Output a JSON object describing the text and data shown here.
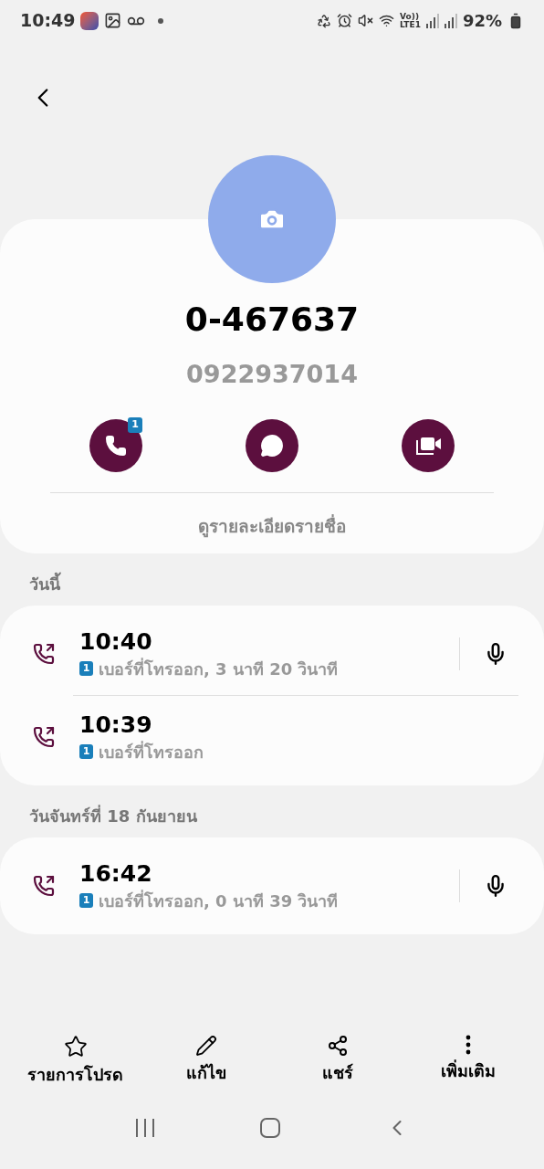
{
  "status_bar": {
    "time": "10:49",
    "volte": "Vo))",
    "network": "LTE1",
    "battery": "92%"
  },
  "contact": {
    "name": "0-467637",
    "number": "0922937014",
    "actions": [
      {
        "kind": "call",
        "badge": "1"
      },
      {
        "kind": "message"
      },
      {
        "kind": "video"
      }
    ],
    "details_link": "ดูรายละเอียดรายชื่อ"
  },
  "sections": [
    {
      "header": "วันนี้",
      "calls": [
        {
          "time": "10:40",
          "sim": "1",
          "detail": "เบอร์ที่โทรออก, 3 นาที 20 วินาที",
          "recording": true
        },
        {
          "time": "10:39",
          "sim": "1",
          "detail": "เบอร์ที่โทรออก",
          "recording": false
        }
      ]
    },
    {
      "header": "วันจันทร์ที่ 18 กันยายน",
      "calls": [
        {
          "time": "16:42",
          "sim": "1",
          "detail": "เบอร์ที่โทรออก, 0 นาที 39 วินาที",
          "recording": true
        }
      ]
    }
  ],
  "bottom_actions": [
    {
      "kind": "favorite",
      "label": "รายการโปรด"
    },
    {
      "kind": "edit",
      "label": "แก้ไข"
    },
    {
      "kind": "share",
      "label": "แชร์"
    },
    {
      "kind": "more",
      "label": "เพิ่มเติม"
    }
  ]
}
